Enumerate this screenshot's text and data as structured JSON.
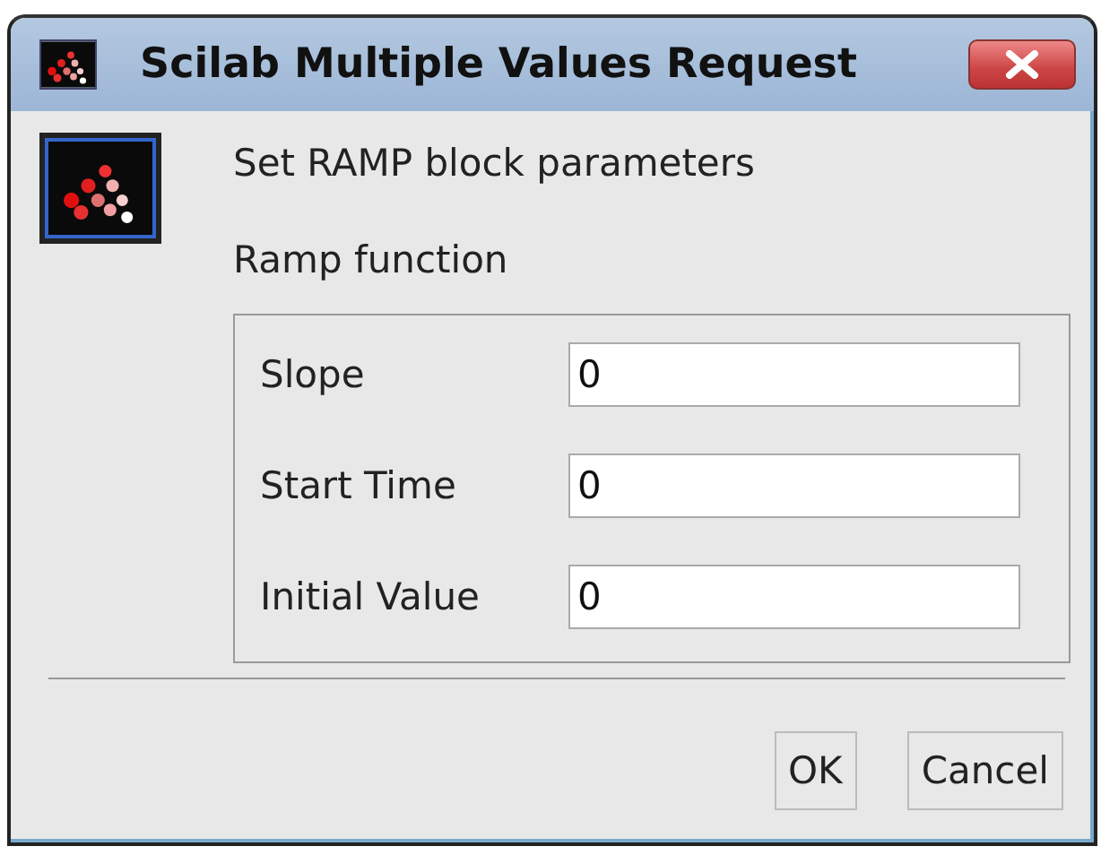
{
  "window": {
    "title": "Scilab Multiple Values Request"
  },
  "message": "Set RAMP block parameters",
  "group": {
    "title": "Ramp function"
  },
  "fields": [
    {
      "label": "Slope",
      "value": "0"
    },
    {
      "label": "Start Time",
      "value": "0"
    },
    {
      "label": "Initial Value",
      "value": "0"
    }
  ],
  "buttons": [
    "OK",
    "Cancel"
  ]
}
